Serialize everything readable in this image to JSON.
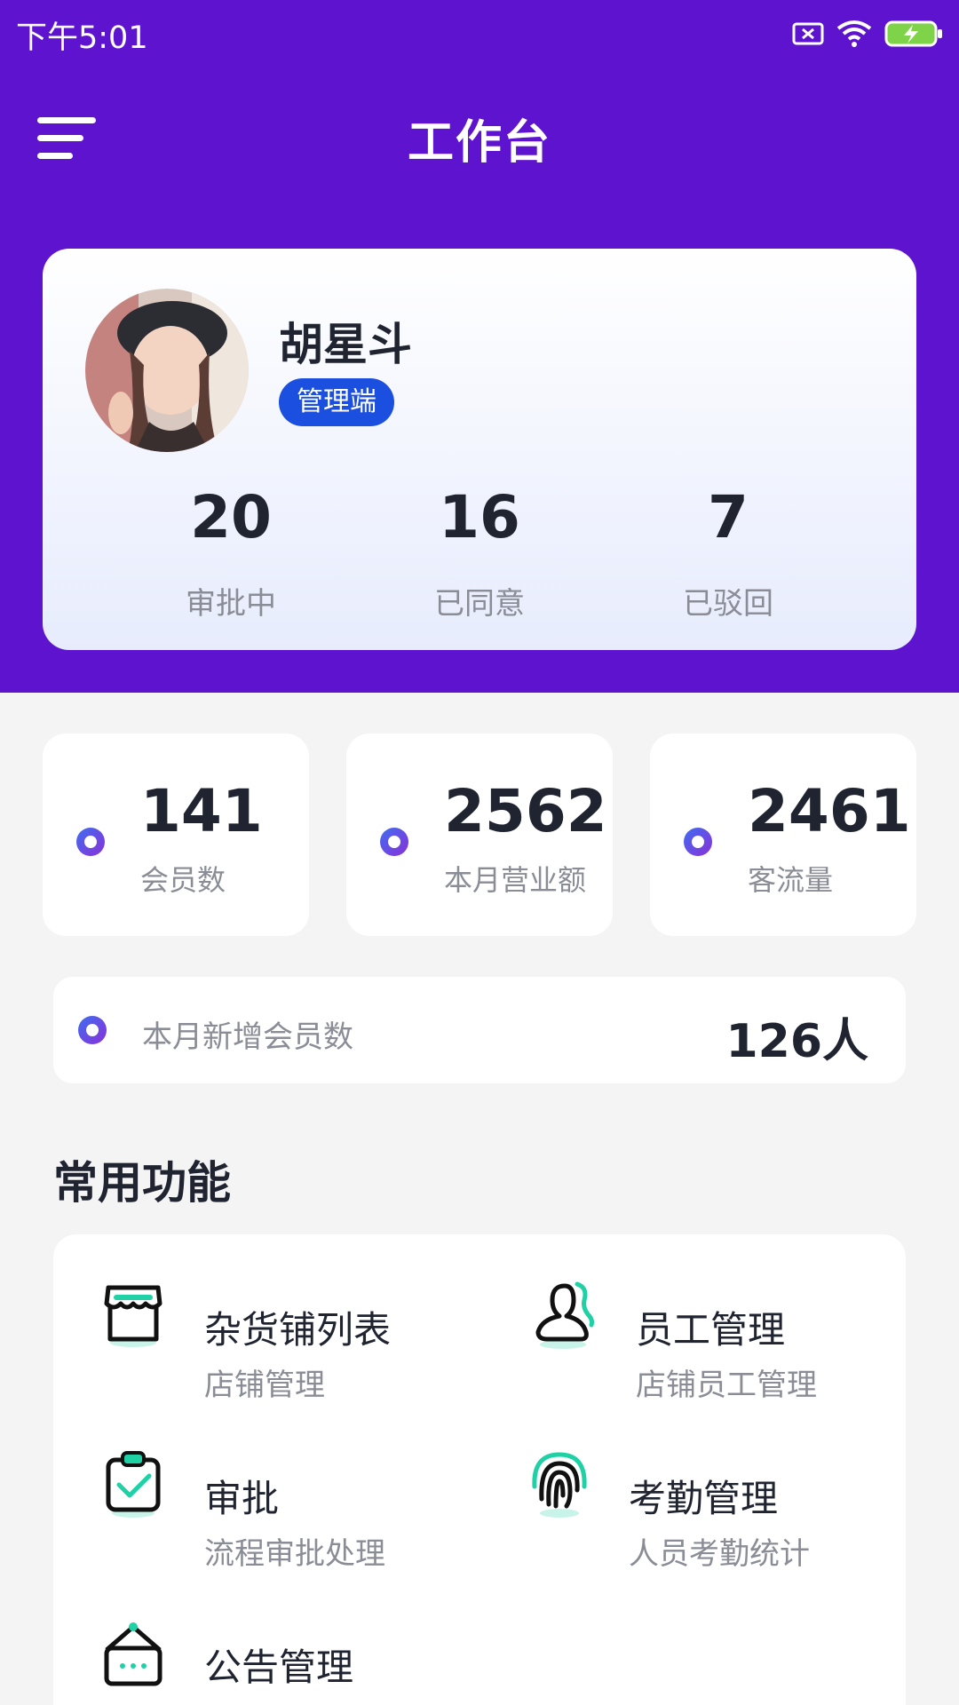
{
  "status_bar": {
    "time": "下午5:01"
  },
  "header": {
    "title": "工作台"
  },
  "profile": {
    "name": "胡星斗",
    "role": "管理端",
    "stats": [
      {
        "value": "20",
        "label": "审批中"
      },
      {
        "value": "16",
        "label": "已同意"
      },
      {
        "value": "7",
        "label": "已驳回"
      }
    ]
  },
  "metrics": [
    {
      "value": "141",
      "label": "会员数"
    },
    {
      "value": "2562",
      "label": "本月营业额"
    },
    {
      "value": "2461",
      "label": "客流量"
    }
  ],
  "new_members": {
    "label": "本月新增会员数",
    "value": "126人"
  },
  "functions": {
    "title": "常用功能",
    "items": [
      {
        "title": "杂货铺列表",
        "subtitle": "店铺管理",
        "icon": "store-icon"
      },
      {
        "title": "员工管理",
        "subtitle": "店铺员工管理",
        "icon": "staff-icon"
      },
      {
        "title": "审批",
        "subtitle": "流程审批处理",
        "icon": "clipboard-check-icon"
      },
      {
        "title": "考勤管理",
        "subtitle": "人员考勤统计",
        "icon": "fingerprint-icon"
      },
      {
        "title": "公告管理",
        "subtitle": "",
        "icon": "notice-icon"
      }
    ]
  },
  "colors": {
    "header_bg": "#5e14cf",
    "accent_blue": "#1a4fe0",
    "icon_accent": "#1fd1a4",
    "page_bg": "#f4f4f5"
  }
}
